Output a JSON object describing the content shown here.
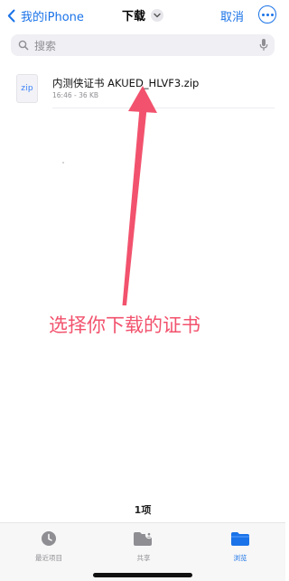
{
  "nav": {
    "back_label": "我的iPhone",
    "title": "下载",
    "cancel_label": "取消"
  },
  "search": {
    "placeholder": "搜索"
  },
  "files": [
    {
      "name": "内测侠证书 AKUED_HLVF3.zip",
      "meta": "16:46 - 36 KB",
      "icon_text": "zip"
    }
  ],
  "annotation": {
    "text": "选择你下载的证书",
    "color": "#f2526d"
  },
  "footer": {
    "count_label": "1项"
  },
  "tabs": [
    {
      "label": "最近项目",
      "icon": "clock-icon",
      "active": false
    },
    {
      "label": "共享",
      "icon": "shared-folder-icon",
      "active": false
    },
    {
      "label": "浏览",
      "icon": "folder-icon",
      "active": true
    }
  ],
  "colors": {
    "accent": "#1a73e8",
    "annotation": "#f2526d"
  }
}
